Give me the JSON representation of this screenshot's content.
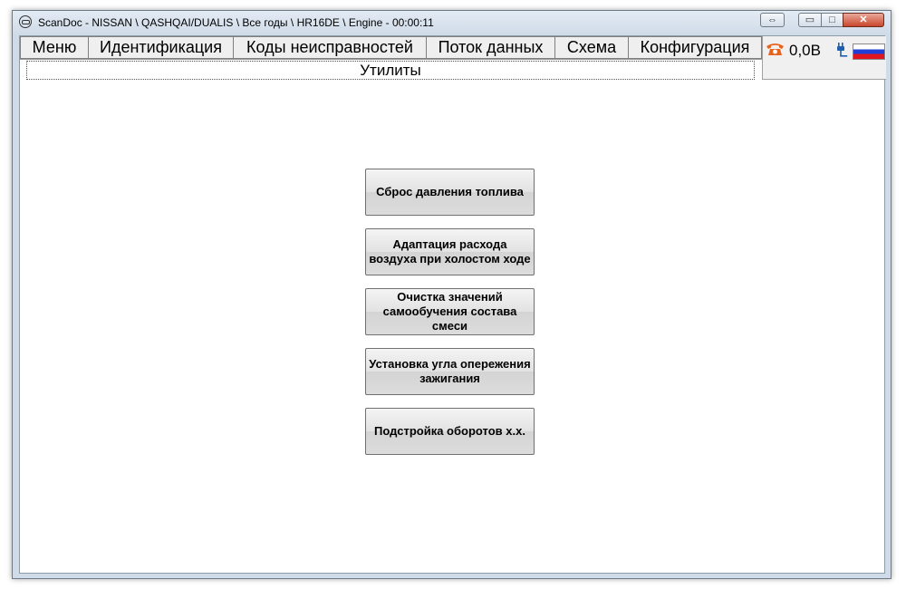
{
  "window": {
    "title": "ScanDoc - NISSAN \\ QASHQAI/DUALIS \\ Все годы \\ HR16DE \\ Engine - 00:00:11",
    "controls": {
      "resize": "⇔",
      "minimize": "▭",
      "maximize": "□",
      "close": "✕"
    }
  },
  "menu": {
    "items": [
      {
        "label": "Меню"
      },
      {
        "label": "Идентификация"
      },
      {
        "label": "Коды неисправностей"
      },
      {
        "label": "Поток данных"
      },
      {
        "label": "Схема"
      },
      {
        "label": "Конфигурация"
      }
    ]
  },
  "status": {
    "voltage": "0,0В",
    "phone_icon": "phone-icon",
    "connection_icon": "plug-icon",
    "language_icon": "russian-flag-icon",
    "phone_color": "#e8641e"
  },
  "subtitle": "Утилиты",
  "buttons": [
    {
      "label": "Сброс давления топлива"
    },
    {
      "label": "Адаптация расхода воздуха при холостом ходе"
    },
    {
      "label": "Очистка значений самообучения состава смеси"
    },
    {
      "label": "Установка угла опережения зажигания"
    },
    {
      "label": "Подстройка оборотов х.х."
    }
  ]
}
